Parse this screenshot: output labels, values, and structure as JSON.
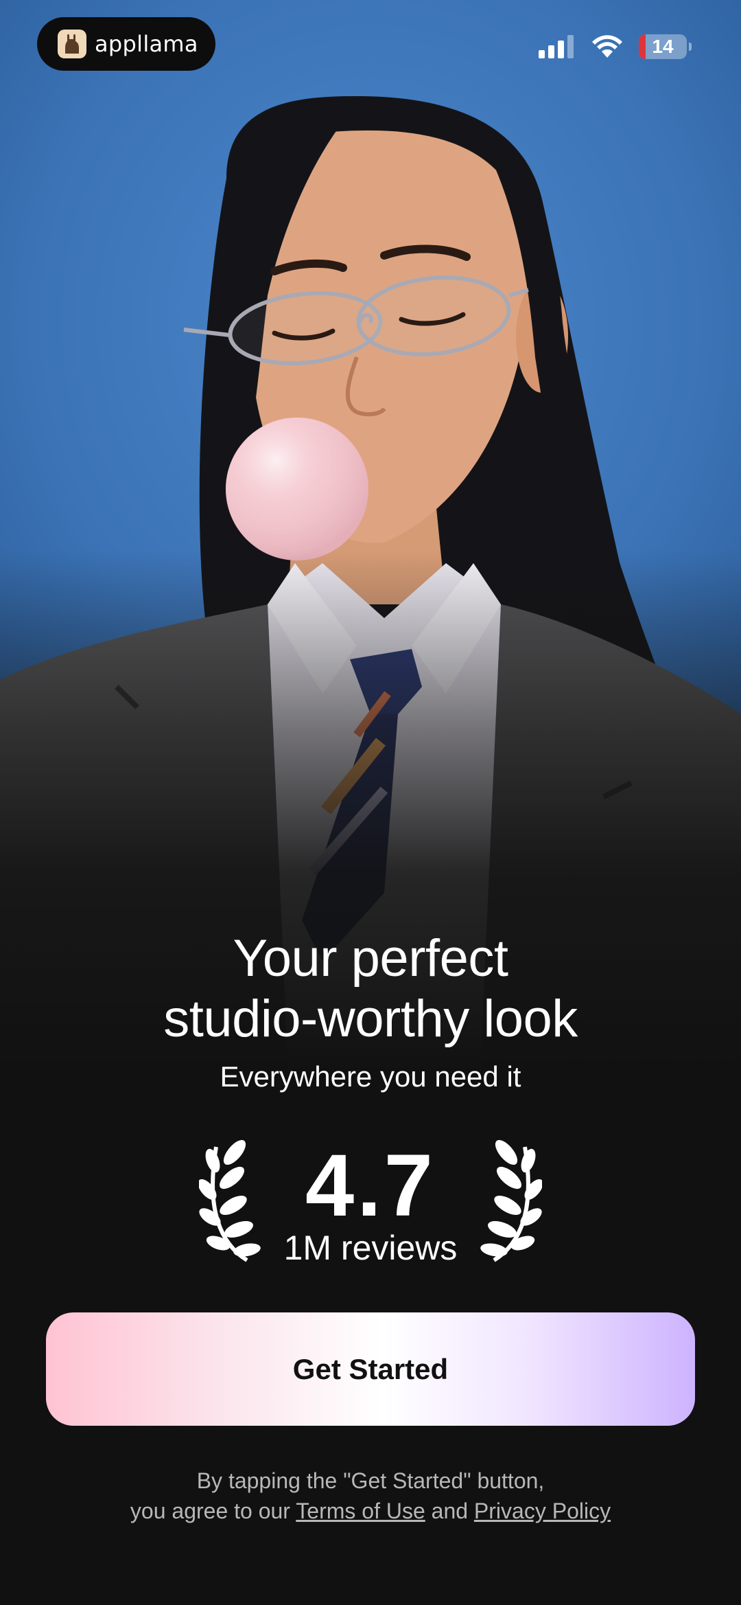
{
  "status_bar": {
    "brand_name": "appllama",
    "battery_level": "14",
    "battery_color": "#e0343b",
    "icons": [
      "cellular-signal-icon",
      "wifi-icon",
      "battery-icon"
    ]
  },
  "hero": {
    "image": "model-portrait-photo",
    "background_color": "#3b73b6"
  },
  "headline": {
    "line1": "Your perfect",
    "line2": "studio-worthy look"
  },
  "subhead": "Everywhere you need it",
  "rating": {
    "value": "4.7",
    "count_label": "1M reviews"
  },
  "cta": {
    "label": "Get Started",
    "gradient": [
      "#ffc3d2",
      "#ffffff",
      "#cdb3ff"
    ]
  },
  "legal": {
    "line1": "By tapping the \"Get Started\" button,",
    "prefix": "you agree to our",
    "terms_link": "Terms of Use",
    "conjunction": "and",
    "privacy_link": "Privacy Policy"
  }
}
